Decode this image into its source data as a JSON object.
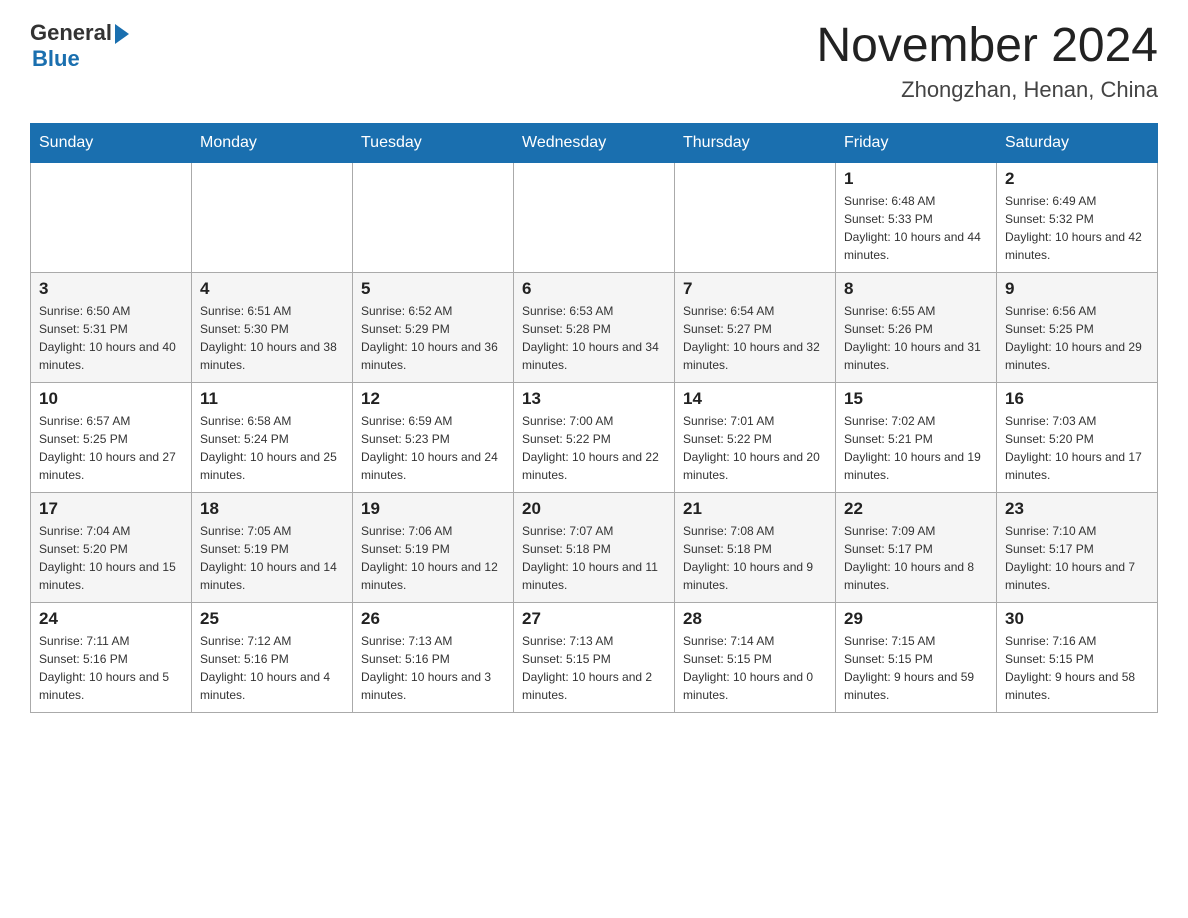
{
  "header": {
    "logo_general": "General",
    "logo_blue": "Blue",
    "month_title": "November 2024",
    "location": "Zhongzhan, Henan, China"
  },
  "weekdays": [
    "Sunday",
    "Monday",
    "Tuesday",
    "Wednesday",
    "Thursday",
    "Friday",
    "Saturday"
  ],
  "weeks": [
    [
      {
        "day": "",
        "info": ""
      },
      {
        "day": "",
        "info": ""
      },
      {
        "day": "",
        "info": ""
      },
      {
        "day": "",
        "info": ""
      },
      {
        "day": "",
        "info": ""
      },
      {
        "day": "1",
        "info": "Sunrise: 6:48 AM\nSunset: 5:33 PM\nDaylight: 10 hours and 44 minutes."
      },
      {
        "day": "2",
        "info": "Sunrise: 6:49 AM\nSunset: 5:32 PM\nDaylight: 10 hours and 42 minutes."
      }
    ],
    [
      {
        "day": "3",
        "info": "Sunrise: 6:50 AM\nSunset: 5:31 PM\nDaylight: 10 hours and 40 minutes."
      },
      {
        "day": "4",
        "info": "Sunrise: 6:51 AM\nSunset: 5:30 PM\nDaylight: 10 hours and 38 minutes."
      },
      {
        "day": "5",
        "info": "Sunrise: 6:52 AM\nSunset: 5:29 PM\nDaylight: 10 hours and 36 minutes."
      },
      {
        "day": "6",
        "info": "Sunrise: 6:53 AM\nSunset: 5:28 PM\nDaylight: 10 hours and 34 minutes."
      },
      {
        "day": "7",
        "info": "Sunrise: 6:54 AM\nSunset: 5:27 PM\nDaylight: 10 hours and 32 minutes."
      },
      {
        "day": "8",
        "info": "Sunrise: 6:55 AM\nSunset: 5:26 PM\nDaylight: 10 hours and 31 minutes."
      },
      {
        "day": "9",
        "info": "Sunrise: 6:56 AM\nSunset: 5:25 PM\nDaylight: 10 hours and 29 minutes."
      }
    ],
    [
      {
        "day": "10",
        "info": "Sunrise: 6:57 AM\nSunset: 5:25 PM\nDaylight: 10 hours and 27 minutes."
      },
      {
        "day": "11",
        "info": "Sunrise: 6:58 AM\nSunset: 5:24 PM\nDaylight: 10 hours and 25 minutes."
      },
      {
        "day": "12",
        "info": "Sunrise: 6:59 AM\nSunset: 5:23 PM\nDaylight: 10 hours and 24 minutes."
      },
      {
        "day": "13",
        "info": "Sunrise: 7:00 AM\nSunset: 5:22 PM\nDaylight: 10 hours and 22 minutes."
      },
      {
        "day": "14",
        "info": "Sunrise: 7:01 AM\nSunset: 5:22 PM\nDaylight: 10 hours and 20 minutes."
      },
      {
        "day": "15",
        "info": "Sunrise: 7:02 AM\nSunset: 5:21 PM\nDaylight: 10 hours and 19 minutes."
      },
      {
        "day": "16",
        "info": "Sunrise: 7:03 AM\nSunset: 5:20 PM\nDaylight: 10 hours and 17 minutes."
      }
    ],
    [
      {
        "day": "17",
        "info": "Sunrise: 7:04 AM\nSunset: 5:20 PM\nDaylight: 10 hours and 15 minutes."
      },
      {
        "day": "18",
        "info": "Sunrise: 7:05 AM\nSunset: 5:19 PM\nDaylight: 10 hours and 14 minutes."
      },
      {
        "day": "19",
        "info": "Sunrise: 7:06 AM\nSunset: 5:19 PM\nDaylight: 10 hours and 12 minutes."
      },
      {
        "day": "20",
        "info": "Sunrise: 7:07 AM\nSunset: 5:18 PM\nDaylight: 10 hours and 11 minutes."
      },
      {
        "day": "21",
        "info": "Sunrise: 7:08 AM\nSunset: 5:18 PM\nDaylight: 10 hours and 9 minutes."
      },
      {
        "day": "22",
        "info": "Sunrise: 7:09 AM\nSunset: 5:17 PM\nDaylight: 10 hours and 8 minutes."
      },
      {
        "day": "23",
        "info": "Sunrise: 7:10 AM\nSunset: 5:17 PM\nDaylight: 10 hours and 7 minutes."
      }
    ],
    [
      {
        "day": "24",
        "info": "Sunrise: 7:11 AM\nSunset: 5:16 PM\nDaylight: 10 hours and 5 minutes."
      },
      {
        "day": "25",
        "info": "Sunrise: 7:12 AM\nSunset: 5:16 PM\nDaylight: 10 hours and 4 minutes."
      },
      {
        "day": "26",
        "info": "Sunrise: 7:13 AM\nSunset: 5:16 PM\nDaylight: 10 hours and 3 minutes."
      },
      {
        "day": "27",
        "info": "Sunrise: 7:13 AM\nSunset: 5:15 PM\nDaylight: 10 hours and 2 minutes."
      },
      {
        "day": "28",
        "info": "Sunrise: 7:14 AM\nSunset: 5:15 PM\nDaylight: 10 hours and 0 minutes."
      },
      {
        "day": "29",
        "info": "Sunrise: 7:15 AM\nSunset: 5:15 PM\nDaylight: 9 hours and 59 minutes."
      },
      {
        "day": "30",
        "info": "Sunrise: 7:16 AM\nSunset: 5:15 PM\nDaylight: 9 hours and 58 minutes."
      }
    ]
  ]
}
